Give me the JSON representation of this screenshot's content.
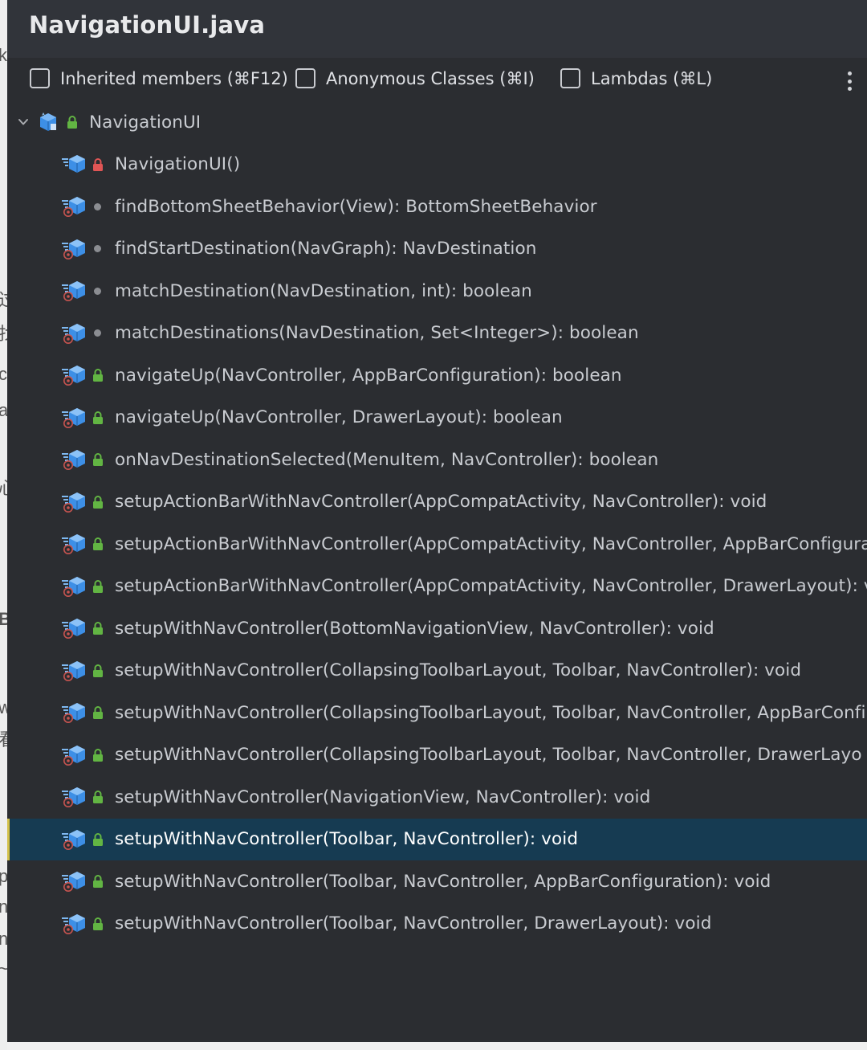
{
  "window": {
    "title": "NavigationUI.java"
  },
  "toolbar": {
    "inherited_members_label": "Inherited members (⌘F12)",
    "anonymous_classes_label": "Anonymous Classes (⌘I)",
    "lambdas_label": "Lambdas (⌘L)",
    "inherited_members_checked": false,
    "anonymous_classes_checked": false,
    "lambdas_checked": false
  },
  "tree": {
    "class_name": "NavigationUI",
    "members": [
      {
        "signature": "NavigationUI()",
        "visibility": "private",
        "icon": "constructor-icon"
      },
      {
        "signature": "findBottomSheetBehavior(View): BottomSheetBehavior",
        "visibility": "package-private",
        "icon": "static-method-icon"
      },
      {
        "signature": "findStartDestination(NavGraph): NavDestination",
        "visibility": "package-private",
        "icon": "static-method-icon"
      },
      {
        "signature": "matchDestination(NavDestination, int): boolean",
        "visibility": "package-private",
        "icon": "static-method-icon"
      },
      {
        "signature": "matchDestinations(NavDestination, Set<Integer>): boolean",
        "visibility": "package-private",
        "icon": "static-method-icon"
      },
      {
        "signature": "navigateUp(NavController, AppBarConfiguration): boolean",
        "visibility": "public",
        "icon": "static-method-icon"
      },
      {
        "signature": "navigateUp(NavController, DrawerLayout): boolean",
        "visibility": "public",
        "icon": "static-method-icon"
      },
      {
        "signature": "onNavDestinationSelected(MenuItem, NavController): boolean",
        "visibility": "public",
        "icon": "static-method-icon"
      },
      {
        "signature": "setupActionBarWithNavController(AppCompatActivity, NavController): void",
        "visibility": "public",
        "icon": "static-method-icon"
      },
      {
        "signature": "setupActionBarWithNavController(AppCompatActivity, NavController, AppBarConfigura",
        "visibility": "public",
        "icon": "static-method-icon"
      },
      {
        "signature": "setupActionBarWithNavController(AppCompatActivity, NavController, DrawerLayout): v",
        "visibility": "public",
        "icon": "static-method-icon"
      },
      {
        "signature": "setupWithNavController(BottomNavigationView, NavController): void",
        "visibility": "public",
        "icon": "static-method-icon"
      },
      {
        "signature": "setupWithNavController(CollapsingToolbarLayout, Toolbar, NavController): void",
        "visibility": "public",
        "icon": "static-method-icon"
      },
      {
        "signature": "setupWithNavController(CollapsingToolbarLayout, Toolbar, NavController, AppBarConfi",
        "visibility": "public",
        "icon": "static-method-icon"
      },
      {
        "signature": "setupWithNavController(CollapsingToolbarLayout, Toolbar, NavController, DrawerLayo",
        "visibility": "public",
        "icon": "static-method-icon"
      },
      {
        "signature": "setupWithNavController(NavigationView, NavController): void",
        "visibility": "public",
        "icon": "static-method-icon"
      },
      {
        "signature": "setupWithNavController(Toolbar, NavController): void",
        "visibility": "public",
        "icon": "static-method-icon",
        "selected": true
      },
      {
        "signature": "setupWithNavController(Toolbar, NavController, AppBarConfiguration): void",
        "visibility": "public",
        "icon": "static-method-icon"
      },
      {
        "signature": "setupWithNavController(Toolbar, NavController, DrawerLayout): void",
        "visibility": "public",
        "icon": "static-method-icon"
      }
    ]
  },
  "background_fragments": [
    "k",
    "过",
    "找",
    "c",
    "a",
    "心",
    "B",
    "w",
    "看",
    "p",
    "n",
    "n",
    "~"
  ],
  "colors": {
    "popup_bg": "#2b2d31",
    "title_bar_bg": "#31343a",
    "selection_bg": "#163b52",
    "selection_marker": "#d3c048",
    "method_icon_blue": "#3d8fe6",
    "static_marker_red": "#c75450",
    "public_lock_green": "#62b543",
    "private_lock_red": "#e05555",
    "package_dot_gray": "#8b8d92"
  }
}
